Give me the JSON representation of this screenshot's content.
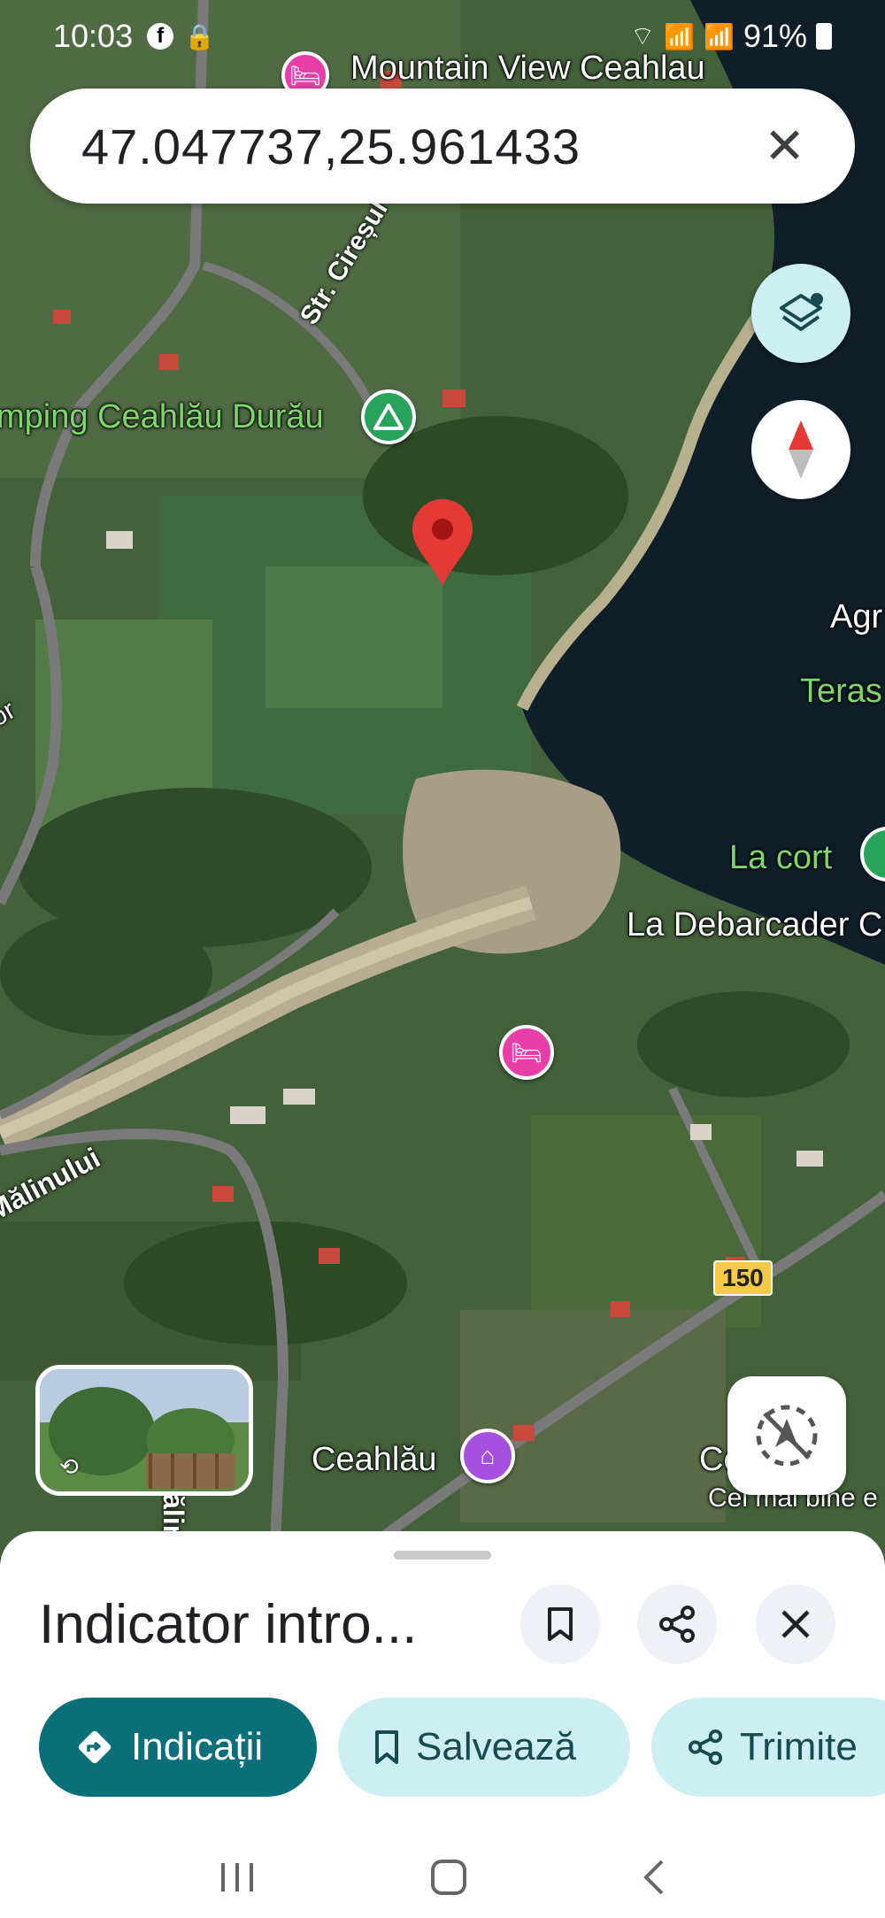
{
  "status_bar": {
    "time": "10:03",
    "battery": "91%"
  },
  "search": {
    "query": "47.047737,25.961433"
  },
  "map": {
    "labels": {
      "mountain_view": "Mountain View Ceahlau",
      "camping": "mping Ceahlău Durău",
      "str_ciresului": "Str. Cireșul",
      "agr": "Agr",
      "teras": "Teras",
      "la_cort": "La cort",
      "la_debarcader": "La Debarcader C",
      "str_malinului_left": "Mălinului",
      "str_malinului_vertical": "Str. Mălinului",
      "ceahlau": "Ceahlău",
      "cel_mai_bine": "Cel mai bine e",
      "ce_la": "Ce      la",
      "or": "or"
    },
    "route_number": "150",
    "colors": {
      "pin": "#e53935",
      "water": "#0f1f2a"
    }
  },
  "sheet": {
    "title": "Indicator intro...",
    "buttons": {
      "directions": "Indicații",
      "save": "Salvează",
      "share": "Trimite"
    }
  },
  "icons": {
    "layers": "layers-icon",
    "compass": "compass-icon",
    "locate": "location-disabled-icon",
    "bookmark": "bookmark-icon",
    "share": "share-icon",
    "close": "close-icon"
  }
}
